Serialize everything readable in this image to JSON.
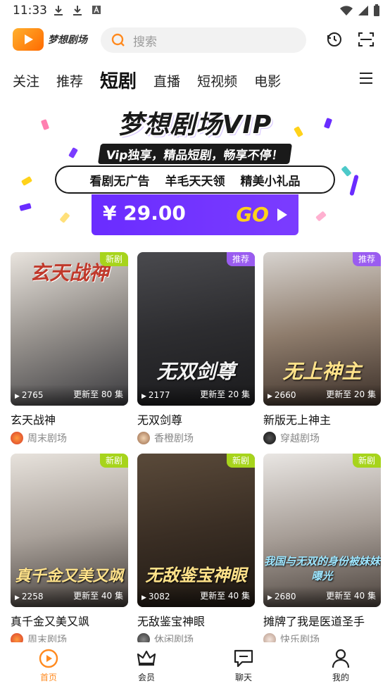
{
  "status_bar": {
    "time": "11:33"
  },
  "app": {
    "name": "梦想剧场"
  },
  "search": {
    "placeholder": "搜索"
  },
  "tabs": [
    {
      "label": "关注",
      "active": false
    },
    {
      "label": "推荐",
      "active": false
    },
    {
      "label": "短剧",
      "active": true
    },
    {
      "label": "直播",
      "active": false
    },
    {
      "label": "短视频",
      "active": false
    },
    {
      "label": "电影",
      "active": false
    }
  ],
  "banner": {
    "title": "梦想剧场VIP",
    "subtitle": "Vip独享，精品短剧，畅享不停！",
    "perks": [
      "看剧无广告",
      "羊毛天天领",
      "精美小礼品"
    ],
    "price": "¥ 29.00",
    "cta": "GO"
  },
  "cards": [
    {
      "title": "玄天战神",
      "badge": "新剧",
      "badge_type": "new",
      "plays": "2765",
      "episodes": "更新至 80 集",
      "source": "周末剧场",
      "caption": "玄天战神"
    },
    {
      "title": "无双剑尊",
      "badge": "推荐",
      "badge_type": "rec",
      "plays": "2177",
      "episodes": "更新至 20 集",
      "source": "香橙剧场",
      "caption": "无双剑尊"
    },
    {
      "title": "新版无上神主",
      "badge": "推荐",
      "badge_type": "rec",
      "plays": "2660",
      "episodes": "更新至 20 集",
      "source": "穿越剧场",
      "caption": "无上神主"
    },
    {
      "title": "真千金又美又飒",
      "badge": "新剧",
      "badge_type": "new",
      "plays": "2258",
      "episodes": "更新至 40 集",
      "source": "周末剧场",
      "caption": "真千金又美又飒"
    },
    {
      "title": "无敌鉴宝神眼",
      "badge": "新剧",
      "badge_type": "new",
      "plays": "3082",
      "episodes": "更新至 40 集",
      "source": "休闲剧场",
      "caption": "无敌鉴宝神眼"
    },
    {
      "title": "摊牌了我是医道圣手",
      "badge": "新剧",
      "badge_type": "new",
      "plays": "2680",
      "episodes": "更新至 40 集",
      "source": "快乐剧场",
      "caption": "我国与无双的身份被妹妹曝光"
    }
  ],
  "bottom_nav": [
    {
      "label": "首页",
      "icon": "home-play-icon",
      "active": true
    },
    {
      "label": "会员",
      "icon": "crown-icon",
      "active": false
    },
    {
      "label": "聊天",
      "icon": "chat-icon",
      "active": false
    },
    {
      "label": "我的",
      "icon": "person-icon",
      "active": false
    }
  ],
  "colors": {
    "accent_orange": "#ff8a1f",
    "badge_new": "#a7d41c",
    "badge_recommend": "#9a5cf0",
    "vip_purple": "#6a2cff"
  }
}
